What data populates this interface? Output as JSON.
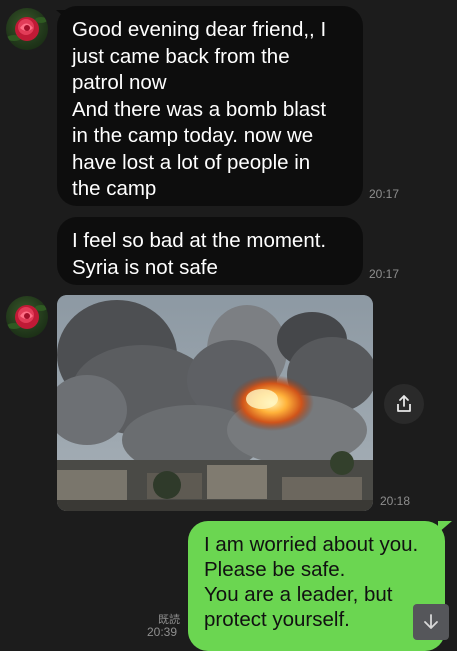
{
  "messages": {
    "msg1_text": "Good evening dear friend,, I\njust came back from the\npatrol now\nAnd there was a bomb blast\nin the camp today. now we\nhave lost a lot of people in\nthe camp",
    "msg1_time": "20:17",
    "msg2_text": "I feel so bad at the moment.\nSyria is not safe",
    "msg2_time": "20:17",
    "photo_time": "20:18",
    "reply_text": "I am worried about you.\nPlease be safe.\nYou are a leader, but\nprotect yourself.",
    "reply_read": "既読",
    "reply_time": "20:39"
  },
  "icons": {
    "avatar": "rose-avatar",
    "share": "share-icon",
    "scroll": "arrow-down-icon"
  },
  "colors": {
    "background": "#1c1c1c",
    "incoming_bubble": "#0d0d0d",
    "outgoing_bubble": "#6bd651",
    "timestamp": "#8e8e8e"
  }
}
